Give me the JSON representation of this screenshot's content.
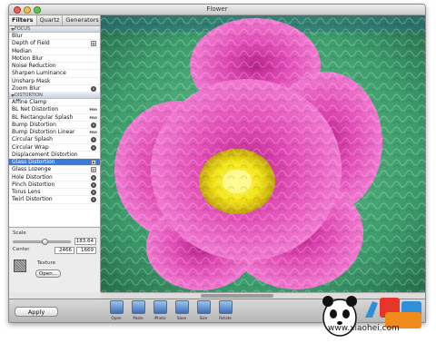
{
  "window": {
    "title": "Flower"
  },
  "tabs": [
    {
      "label": "Filters",
      "selected": true
    },
    {
      "label": "Quartz",
      "selected": false
    },
    {
      "label": "Generators",
      "selected": false
    }
  ],
  "filter_groups": [
    {
      "name": "FOCUS",
      "items": [
        {
          "label": "Blur",
          "badge": ""
        },
        {
          "label": "Depth of Field",
          "badge": "grid"
        },
        {
          "label": "Median",
          "badge": ""
        },
        {
          "label": "Motion Blur",
          "badge": ""
        },
        {
          "label": "Noise Reduction",
          "badge": ""
        },
        {
          "label": "Sharpen Luminance",
          "badge": ""
        },
        {
          "label": "Unsharp Mask",
          "badge": ""
        },
        {
          "label": "Zoom Blur",
          "badge": "x"
        }
      ]
    },
    {
      "name": "DISTORTION",
      "items": [
        {
          "label": "Affine Clamp",
          "badge": ""
        },
        {
          "label": "BL Net Distortion",
          "badge": "PRO"
        },
        {
          "label": "BL Rectangular Splash",
          "badge": "PRO"
        },
        {
          "label": "Bump Distortion",
          "badge": "x"
        },
        {
          "label": "Bump Distortion Linear",
          "badge": "PRO"
        },
        {
          "label": "Circular Splash",
          "badge": "x"
        },
        {
          "label": "Circular Wrap",
          "badge": "x"
        },
        {
          "label": "Displacement Distortion",
          "badge": ""
        },
        {
          "label": "Glass Distortion",
          "badge": "sq",
          "selected": true
        },
        {
          "label": "Glass Lozenge",
          "badge": "grid"
        },
        {
          "label": "Hole Distortion",
          "badge": "x"
        },
        {
          "label": "Pinch Distortion",
          "badge": "x"
        },
        {
          "label": "Torus Lens",
          "badge": "x"
        },
        {
          "label": "Twirl Distortion",
          "badge": "x"
        }
      ]
    }
  ],
  "params": {
    "scale_label": "Scale",
    "scale_value": "183.64",
    "scale_fraction": 0.55,
    "center_label": "Center",
    "center_x": "2466",
    "center_y": "1669",
    "texture_label": "Texture",
    "open_label": "Open..."
  },
  "apply_label": "Apply",
  "toolbar": [
    {
      "label": "Open",
      "icon": "open-icon"
    },
    {
      "label": "Paste",
      "icon": "paste-icon"
    },
    {
      "label": "iPhoto",
      "icon": "iphoto-icon"
    },
    {
      "label": "Save",
      "icon": "save-icon"
    },
    {
      "label": "Size",
      "icon": "size-icon"
    },
    {
      "label": "Rotate",
      "icon": "rotate-icon"
    }
  ],
  "watermark": {
    "text": "小黑游戏",
    "url": "www.xiaohei.com"
  },
  "colors": {
    "selection": "#3d7ad6",
    "petal": "#e04ab4",
    "center": "#f2e414",
    "background": "#3f9a6a"
  }
}
